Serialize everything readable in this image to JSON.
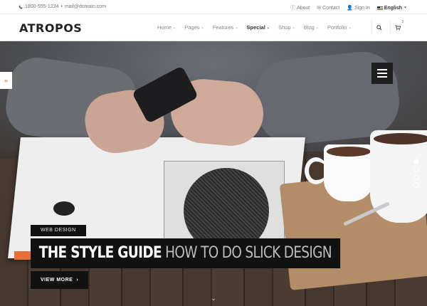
{
  "topbar": {
    "phone": "1800-555-1234",
    "separator": "•",
    "email": "mail@domain.com",
    "links": [
      {
        "icon": "info-icon",
        "label": "About"
      },
      {
        "icon": "mail-icon",
        "label": "Contact"
      },
      {
        "icon": "user-icon",
        "label": "Sign In"
      }
    ],
    "language": "English"
  },
  "header": {
    "logo": "ATROPOS",
    "nav": [
      {
        "label": "Home",
        "active": false
      },
      {
        "label": "Pages",
        "active": false
      },
      {
        "label": "Features",
        "active": false
      },
      {
        "label": "Special",
        "active": true
      },
      {
        "label": "Shop",
        "active": false
      },
      {
        "label": "Blog",
        "active": false
      },
      {
        "label": "Portfolio",
        "active": false
      }
    ],
    "cart_count": "3",
    "caret": "⌄"
  },
  "hero": {
    "side_toggle": "»",
    "tag": "WEB DESIGN",
    "title_strong": "THE STYLE GUIDE",
    "title_light": "HOW TO DO SLICK DESIGN",
    "button": "VIEW MORE",
    "button_arrow": "›",
    "scroll_icon": "⌄",
    "slides_total": 4,
    "slide_active": 1
  },
  "colors": {
    "accent": "#e0663b",
    "caption_bg": "#111111"
  }
}
